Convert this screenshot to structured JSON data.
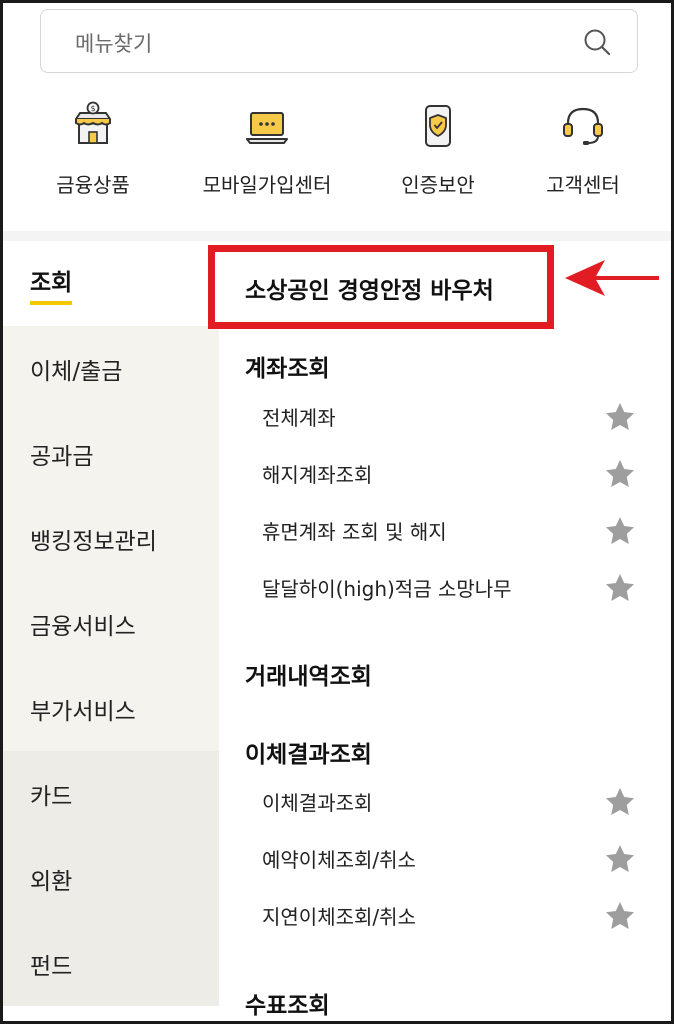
{
  "search": {
    "placeholder": "메뉴찾기"
  },
  "quick_menu": [
    {
      "label": "금융상품",
      "icon": "store-dollar-icon"
    },
    {
      "label": "모바일가입센터",
      "icon": "laptop-chat-icon"
    },
    {
      "label": "인증보안",
      "icon": "phone-shield-icon"
    },
    {
      "label": "고객센터",
      "icon": "headset-icon"
    }
  ],
  "categories": [
    "조회",
    "이체/출금",
    "공과금",
    "뱅킹정보관리",
    "금융서비스",
    "부가서비스",
    "카드",
    "외환",
    "펀드"
  ],
  "highlight": {
    "title": "소상공인 경영안정 바우처"
  },
  "sections": [
    {
      "title": "계좌조회",
      "items": [
        "전체계좌",
        "해지계좌조회",
        "휴면계좌 조회 및 해지",
        "달달하이(high)적금 소망나무"
      ]
    },
    {
      "title": "거래내역조회",
      "items": []
    },
    {
      "title": "이체결과조회",
      "items": [
        "이체결과조회",
        "예약이체조회/취소",
        "지연이체조회/취소"
      ]
    },
    {
      "title": "수표조회",
      "items": []
    }
  ],
  "colors": {
    "accent_yellow": "#f5c800",
    "highlight_red": "#e21c23",
    "star_grey": "#9e9e9e",
    "sidebar_beige": "#f5f3ee"
  }
}
